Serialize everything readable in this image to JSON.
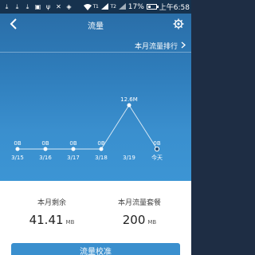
{
  "status_bar": {
    "battery": "17%",
    "time_text": "上午6:58",
    "indicator_t1": "T1",
    "indicator_t2": "T2",
    "left_icons": [
      "download-icon",
      "download-icon",
      "download-icon",
      "app-icon",
      "usb-icon",
      "usb-debug-icon",
      "android-icon"
    ],
    "right_icons": [
      "wifi-icon",
      "signal-icon",
      "battery-icon"
    ]
  },
  "header": {
    "title": "流量",
    "back_icon": "back-arrow-icon",
    "settings_icon": "gear-icon"
  },
  "ranking": {
    "label": "本月流量排行",
    "icon": "chevron-right-icon"
  },
  "chart_data": {
    "type": "line",
    "categories": [
      "3/15",
      "3/16",
      "3/17",
      "3/18",
      "3/19",
      "今天"
    ],
    "values": [
      0,
      0,
      0,
      0,
      12.6,
      0
    ],
    "value_labels": [
      "0B",
      "0B",
      "0B",
      "0B",
      "12.6M",
      "0B"
    ],
    "color": "#ffffff",
    "grid": false
  },
  "summary": {
    "remaining_label": "本月剩余",
    "remaining_value": "41.41",
    "remaining_unit": "MB",
    "plan_label": "本月流量套餐",
    "plan_value": "200",
    "plan_unit": "MB"
  },
  "button": {
    "label": "流量校准"
  },
  "colors": {
    "status_bar": "#16324e",
    "gradient_top": "#2a6ea8",
    "gradient_bottom": "#3c95d4",
    "accent": "#3a8fce"
  }
}
